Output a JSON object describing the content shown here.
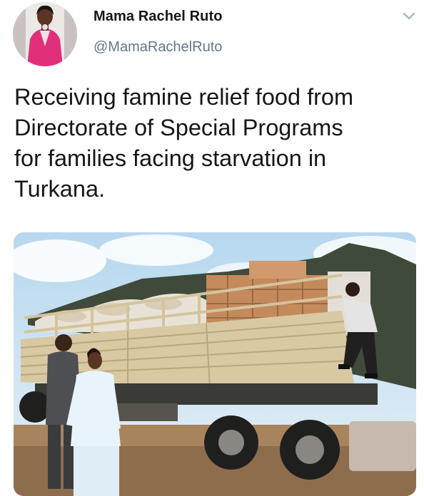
{
  "tweet": {
    "author_name": "Mama Rachel Ruto",
    "author_handle": "@MamaRachelRuto",
    "text": "Receiving famine relief food from\nDirectorate of Special Programs\nfor families facing starvation in\nTurkana.",
    "icons": {
      "avatar": "profile-avatar",
      "menu": "chevron-down-icon"
    },
    "media": {
      "type": "photo"
    }
  },
  "colors": {
    "text_primary": "#14171a",
    "text_secondary": "#657786",
    "chevron": "#aab8c2"
  }
}
